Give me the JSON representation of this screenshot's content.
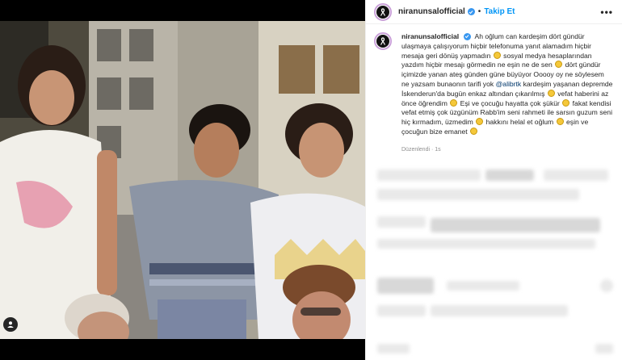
{
  "post": {
    "username": "niranunsalofficial",
    "verified": true,
    "separator": "•",
    "follow_label": "Takip Et",
    "more_label": "•••",
    "caption": {
      "p1": "Ah oğlum can kardeşim dört gündür ulaşmaya çalışıyorum hiçbir telefonuma yanıt alamadım hiçbir mesaja geri dönüş yapmadın",
      "p2": "sosyal medya hesaplarından yazdım hiçbir mesajı görmedin ne eşin ne de sen",
      "p3": "dört gündür içimizde yanan ateş günden güne büyüyor Ooooy oy ne söylesem ne yazsam bunaonın tarifi yok",
      "mention": "@alibrtk",
      "p4": "kardeşim yaşanan depremde İskenderun'da bugün enkaz altından çıkarılmış",
      "p5": "vefat haberini az önce öğrendim",
      "p6": "Eşi ve çocuğu hayatta çok şükür",
      "p7": "fakat kendisi vefat etmiş çok üzgünüm Rabb'im seni rahmeti ile sarsın guzum seni hiç kırmadım, üzmedim",
      "p8": "hakkını helal et oğlum",
      "p9": "eşin ve çocuğun bize emanet"
    },
    "edited_label": "Düzenlendi · 1s"
  },
  "colors": {
    "follow": "#0095f6",
    "verified": "#3897f0",
    "mention": "#00376b"
  },
  "icons": {
    "avatar": "black-ribbon-avatar",
    "tag": "user-tag-icon",
    "verified": "verified-badge-icon",
    "emoji": "sad-face-emoji"
  }
}
